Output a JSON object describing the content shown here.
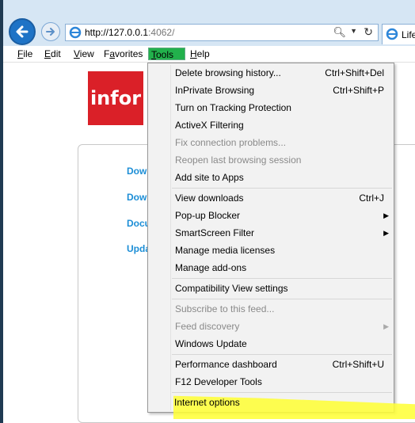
{
  "browser": {
    "url_main": "http://127.0.0.1",
    "url_port": ":4062/",
    "tab_label": "Life",
    "back_icon": "back-arrow-icon",
    "forward_icon": "forward-arrow-icon"
  },
  "menubar": {
    "items": [
      {
        "label": "File",
        "underline": "F"
      },
      {
        "label": "Edit",
        "underline": "E"
      },
      {
        "label": "View",
        "underline": "V"
      },
      {
        "label": "Favorites",
        "underline": "a"
      },
      {
        "label": "Tools",
        "underline": "T"
      },
      {
        "label": "Help",
        "underline": "H"
      }
    ],
    "active_color": "#22b14c"
  },
  "page": {
    "logo_text": "infor",
    "links": [
      "Dowr",
      "Dowr",
      "Docu",
      "Upda"
    ],
    "logo_color": "#da2028",
    "link_color": "#1c8ed6"
  },
  "tools_menu": {
    "items": [
      {
        "label": "Delete browsing history...",
        "shortcut": "Ctrl+Shift+Del",
        "disabled": false
      },
      {
        "label": "InPrivate Browsing",
        "shortcut": "Ctrl+Shift+P",
        "disabled": false
      },
      {
        "label": "Turn on Tracking Protection",
        "shortcut": "",
        "disabled": false
      },
      {
        "label": "ActiveX Filtering",
        "shortcut": "",
        "disabled": false
      },
      {
        "label": "Fix connection problems...",
        "shortcut": "",
        "disabled": true
      },
      {
        "label": "Reopen last browsing session",
        "shortcut": "",
        "disabled": true
      },
      {
        "label": "Add site to Apps",
        "shortcut": "",
        "disabled": false
      },
      {
        "label": "View downloads",
        "shortcut": "Ctrl+J",
        "disabled": false
      },
      {
        "label": "Pop-up Blocker",
        "shortcut": "",
        "disabled": false,
        "submenu": true
      },
      {
        "label": "SmartScreen Filter",
        "shortcut": "",
        "disabled": false,
        "submenu": true
      },
      {
        "label": "Manage media licenses",
        "shortcut": "",
        "disabled": false
      },
      {
        "label": "Manage add-ons",
        "shortcut": "",
        "disabled": false
      },
      {
        "label": "Compatibility View settings",
        "shortcut": "",
        "disabled": false
      },
      {
        "label": "Subscribe to this feed...",
        "shortcut": "",
        "disabled": true
      },
      {
        "label": "Feed discovery",
        "shortcut": "",
        "disabled": true,
        "submenu": true
      },
      {
        "label": "Windows Update",
        "shortcut": "",
        "disabled": false
      },
      {
        "label": "Performance dashboard",
        "shortcut": "Ctrl+Shift+U",
        "disabled": false
      },
      {
        "label": "F12 Developer Tools",
        "shortcut": "",
        "disabled": false
      },
      {
        "label": "Internet options",
        "shortcut": "",
        "disabled": false
      }
    ],
    "highlight_color": "#ffff33"
  }
}
